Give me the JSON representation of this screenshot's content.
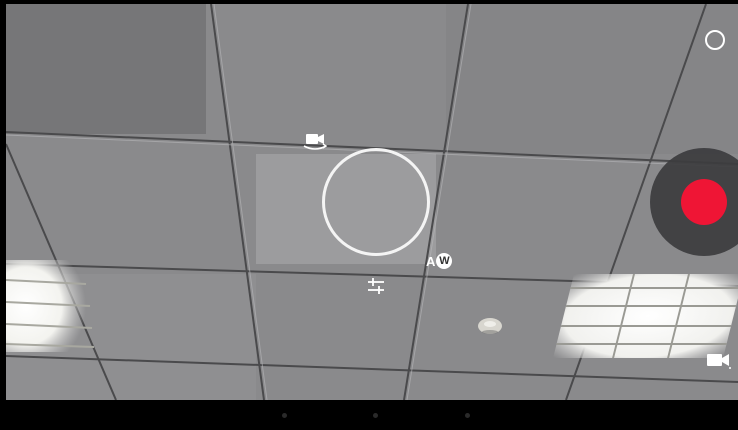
{
  "camera": {
    "white_balance_label": "A",
    "white_balance_badge": "W",
    "shutter_color": "#ef1535",
    "icons": [
      "mode-circle-icon",
      "switch-camera-icon",
      "settings-sliders-icon",
      "video-mode-icon"
    ]
  },
  "nav_bar": {
    "buttons": [
      "back-button",
      "home-button",
      "recents-button"
    ]
  }
}
